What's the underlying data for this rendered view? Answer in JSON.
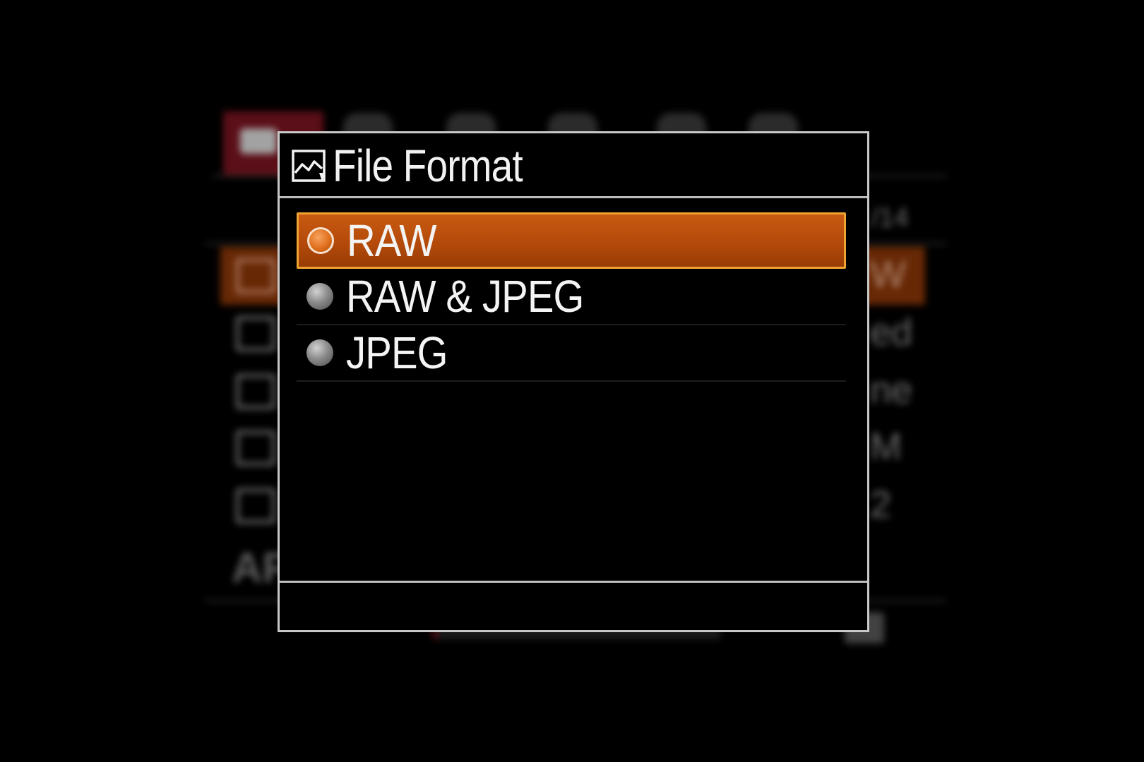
{
  "dialog": {
    "title": "File Format",
    "title_icon": "image-file-icon",
    "options": [
      {
        "label": "RAW",
        "selected": true
      },
      {
        "label": "RAW & JPEG",
        "selected": false
      },
      {
        "label": "JPEG",
        "selected": false
      }
    ]
  },
  "colors": {
    "selection_fill": "#b44a0a",
    "selection_border": "#f0a330",
    "dialog_border": "#c8c8c8",
    "background": "#000000",
    "text": "#f4f4f4"
  }
}
